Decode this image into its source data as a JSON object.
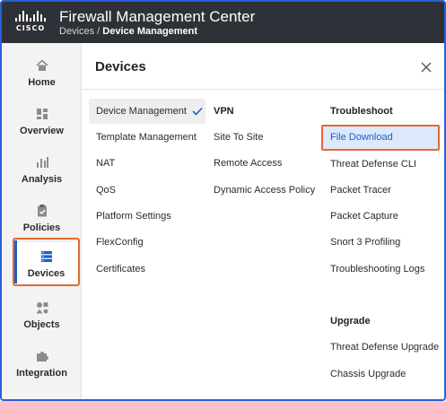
{
  "header": {
    "logo_text": "CISCO",
    "title": "Firewall Management Center",
    "breadcrumb_parent": "Devices",
    "breadcrumb_sep": " / ",
    "breadcrumb_current": "Device Management"
  },
  "sidebar": {
    "items": [
      {
        "label": "Home",
        "icon": "home-icon"
      },
      {
        "label": "Overview",
        "icon": "dashboard-icon"
      },
      {
        "label": "Analysis",
        "icon": "bar-chart-icon"
      },
      {
        "label": "Policies",
        "icon": "clipboard-icon"
      },
      {
        "label": "Devices",
        "icon": "server-icon",
        "active": true
      },
      {
        "label": "Objects",
        "icon": "shapes-icon"
      },
      {
        "label": "Integration",
        "icon": "puzzle-icon"
      }
    ]
  },
  "panel": {
    "title": "Devices",
    "columns": {
      "devices": {
        "items": [
          "Device Management",
          "Template Management",
          "NAT",
          "QoS",
          "Platform Settings",
          "FlexConfig",
          "Certificates"
        ],
        "selected": "Device Management"
      },
      "vpn": {
        "heading": "VPN",
        "items": [
          "Site To Site",
          "Remote Access",
          "Dynamic Access Policy"
        ]
      },
      "troubleshoot": {
        "heading": "Troubleshoot",
        "items": [
          "File Download",
          "Threat Defense CLI",
          "Packet Tracer",
          "Packet Capture",
          "Snort 3 Profiling",
          "Troubleshooting Logs"
        ],
        "highlighted": "File Download"
      },
      "upgrade": {
        "heading": "Upgrade",
        "items": [
          "Threat Defense Upgrade",
          "Chassis Upgrade"
        ]
      }
    }
  },
  "colors": {
    "header_bg": "#2f3138",
    "accent_blue": "#1a5fc8",
    "highlight_orange": "#e36a2e",
    "selected_bg": "#dce8fb"
  }
}
